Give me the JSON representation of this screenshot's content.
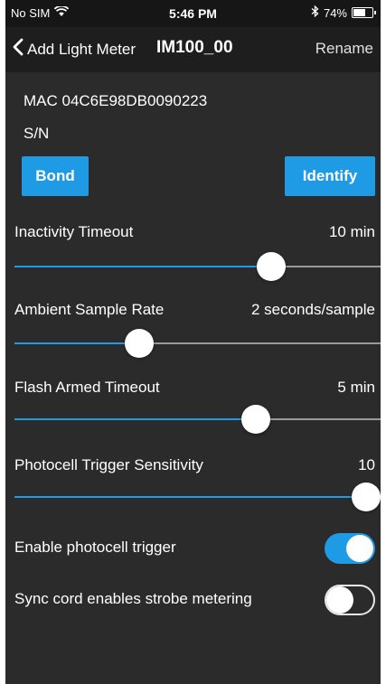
{
  "status_bar": {
    "carrier": "No SIM",
    "wifi_icon": "wifi-icon",
    "time": "5:46 PM",
    "bluetooth_icon": "bluetooth-icon",
    "battery_percent": "74%",
    "battery_level": 0.74
  },
  "nav": {
    "back_label": "Add Light Meter",
    "title": "IM100_00",
    "right_label": "Rename"
  },
  "device": {
    "mac": "MAC 04C6E98DB0090223",
    "sn": "S/N"
  },
  "buttons": {
    "bond": "Bond",
    "identify": "Identify"
  },
  "accent_color": "#1f9be6",
  "settings": [
    {
      "label": "Inactivity Timeout",
      "value": "10 min",
      "level": 0.7
    },
    {
      "label": "Ambient Sample Rate",
      "value": "2 seconds/sample",
      "level": 0.34
    },
    {
      "label": "Flash Armed Timeout",
      "value": "5 min",
      "level": 0.66
    },
    {
      "label": "Photocell Trigger Sensitivity",
      "value": "10",
      "level": 0.96
    }
  ],
  "toggles": [
    {
      "label": "Enable photocell trigger",
      "on": true
    },
    {
      "label": "Sync cord enables strobe metering",
      "on": false
    }
  ]
}
